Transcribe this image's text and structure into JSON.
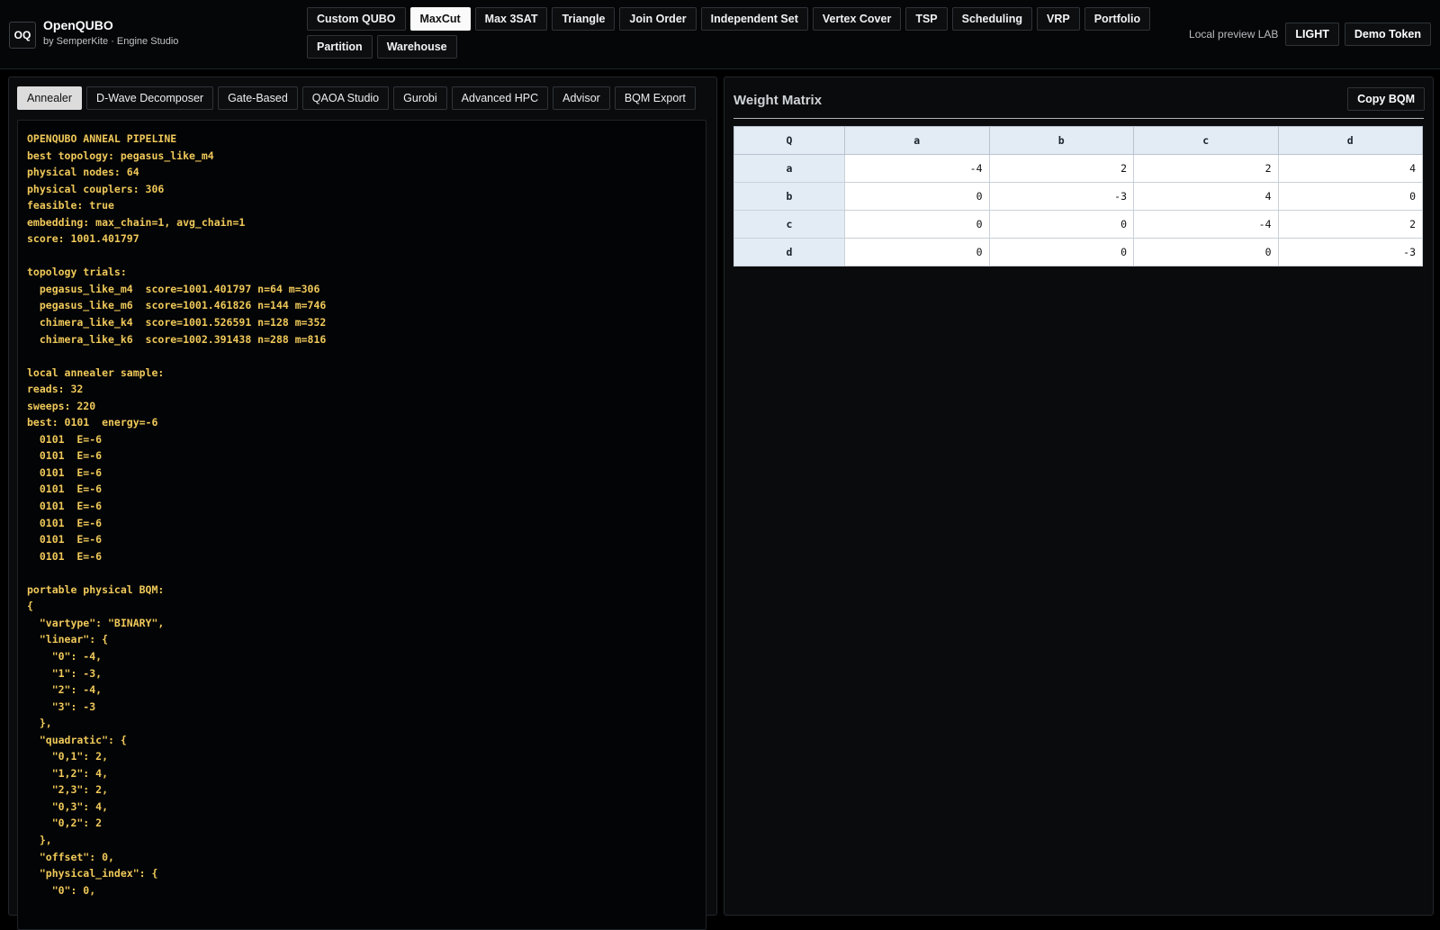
{
  "app": {
    "logo": "OQ",
    "title": "OpenQUBO",
    "subtitle": "by SemperKite · Engine Studio"
  },
  "nav": {
    "items": [
      "Custom QUBO",
      "MaxCut",
      "Max 3SAT",
      "Triangle",
      "Join Order",
      "Independent Set",
      "Vertex Cover",
      "TSP",
      "Scheduling",
      "VRP",
      "Portfolio",
      "Partition",
      "Warehouse"
    ],
    "active": "MaxCut"
  },
  "header_right": {
    "preview_label": "Local preview LAB",
    "light_button": "LIGHT",
    "token_button": "Demo Token"
  },
  "tabs": {
    "items": [
      "Annealer",
      "D-Wave Decomposer",
      "Gate-Based",
      "QAOA Studio",
      "Gurobi",
      "Advanced HPC",
      "Advisor",
      "BQM Export"
    ],
    "active": "Annealer"
  },
  "console": {
    "lines": [
      "OPENQUBO ANNEAL PIPELINE",
      "best topology: pegasus_like_m4",
      "physical nodes: 64",
      "physical couplers: 306",
      "feasible: true",
      "embedding: max_chain=1, avg_chain=1",
      "score: 1001.401797",
      "",
      "topology trials:",
      "  pegasus_like_m4  score=1001.401797 n=64 m=306",
      "  pegasus_like_m6  score=1001.461826 n=144 m=746",
      "  chimera_like_k4  score=1001.526591 n=128 m=352",
      "  chimera_like_k6  score=1002.391438 n=288 m=816",
      "",
      "local annealer sample:",
      "reads: 32",
      "sweeps: 220",
      "best: 0101  energy=-6",
      "  0101  E=-6",
      "  0101  E=-6",
      "  0101  E=-6",
      "  0101  E=-6",
      "  0101  E=-6",
      "  0101  E=-6",
      "  0101  E=-6",
      "  0101  E=-6",
      "",
      "portable physical BQM:",
      "{",
      "  \"vartype\": \"BINARY\",",
      "  \"linear\": {",
      "    \"0\": -4,",
      "    \"1\": -3,",
      "    \"2\": -4,",
      "    \"3\": -3",
      "  },",
      "  \"quadratic\": {",
      "    \"0,1\": 2,",
      "    \"1,2\": 4,",
      "    \"2,3\": 2,",
      "    \"0,3\": 4,",
      "    \"0,2\": 2",
      "  },",
      "  \"offset\": 0,",
      "  \"physical_index\": {",
      "    \"0\": 0,"
    ]
  },
  "matrix": {
    "title": "Weight Matrix",
    "copy_button": "Copy BQM",
    "corner": "Q",
    "columns": [
      "a",
      "b",
      "c",
      "d"
    ],
    "rows": [
      {
        "label": "a",
        "values": [
          "-4",
          "2",
          "2",
          "4"
        ]
      },
      {
        "label": "b",
        "values": [
          "0",
          "-3",
          "4",
          "0"
        ]
      },
      {
        "label": "c",
        "values": [
          "0",
          "0",
          "-4",
          "2"
        ]
      },
      {
        "label": "d",
        "values": [
          "0",
          "0",
          "0",
          "-3"
        ]
      }
    ]
  }
}
